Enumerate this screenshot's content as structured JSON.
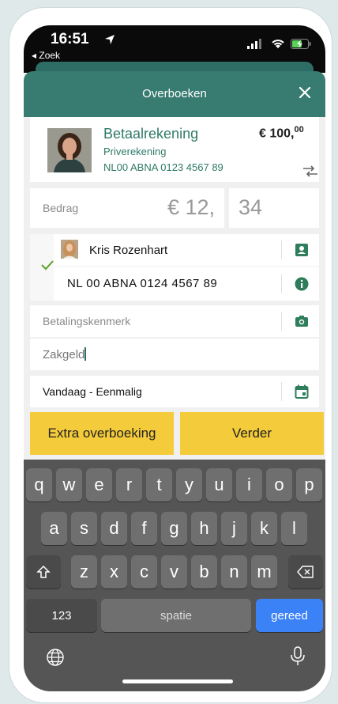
{
  "status_bar": {
    "time": "16:51",
    "back_label": "◂ Zoek"
  },
  "header": {
    "title": "Overboeken",
    "close_icon": "close-icon"
  },
  "from_account": {
    "name": "Betaalrekening",
    "type": "Priverekening",
    "iban": "NL00 ABNA 0123 4567 89",
    "balance_main": "€ 100,",
    "balance_cents": "00",
    "swap_icon": "swap-arrows-icon"
  },
  "amount": {
    "label": "Bedrag",
    "euros": "€ 12,",
    "cents": "34"
  },
  "beneficiary": {
    "name": "Kris Rozenhart",
    "iban": "NL 00  ABNA  0124  4567  89",
    "contact_icon": "contact-card-icon",
    "info_icon": "info-icon",
    "check_icon": "check-icon"
  },
  "payment_reference": {
    "placeholder": "Betalingskenmerk",
    "camera_icon": "camera-icon"
  },
  "description": {
    "value": "Zakgeld"
  },
  "schedule": {
    "value": "Vandaag - Eenmalig",
    "calendar_icon": "calendar-icon"
  },
  "buttons": {
    "extra": "Extra overboeking",
    "next": "Verder"
  },
  "keyboard": {
    "row1": [
      "q",
      "w",
      "e",
      "r",
      "t",
      "y",
      "u",
      "i",
      "o",
      "p"
    ],
    "row2": [
      "a",
      "s",
      "d",
      "f",
      "g",
      "h",
      "j",
      "k",
      "l"
    ],
    "row3": [
      "z",
      "x",
      "c",
      "v",
      "b",
      "n",
      "m"
    ],
    "numbers": "123",
    "space": "spatie",
    "done": "gereed"
  },
  "colors": {
    "brand_green": "#377b71",
    "text_green": "#2f7a67",
    "button_yellow": "#f4cb3a",
    "keyboard_blue": "#3b82f6"
  }
}
